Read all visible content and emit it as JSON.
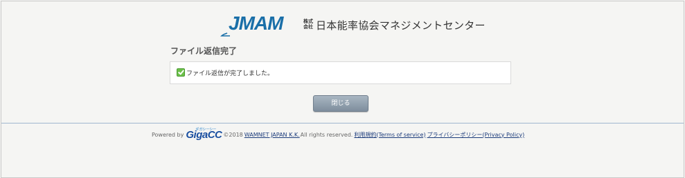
{
  "header": {
    "logo_mark": "JMAM",
    "logo_small_label": "株式会社",
    "company_name": "日本能率協会マネジメントセンター"
  },
  "page": {
    "title": "ファイル返信完了"
  },
  "message": {
    "icon": "check-icon",
    "text": "ファイル返信が完了しました。"
  },
  "buttons": {
    "close_label": "閉じる"
  },
  "footer": {
    "powered_by": "Powered by",
    "gigacc_small": "ギガシーシー",
    "gigacc_brand": "GigaCC",
    "copyright": "©2018 ",
    "company_link": "WAMNET JAPAN K.K.",
    "rights": " All rights reserved.",
    "terms_link": "利用規約(Terms of service)",
    "privacy_link": "プライバシーポリシー(Privacy Policy)"
  },
  "colors": {
    "accent_blue": "#1a4fa0",
    "logo_teal": "#1a6fa8",
    "success_green": "#6cc04a"
  }
}
